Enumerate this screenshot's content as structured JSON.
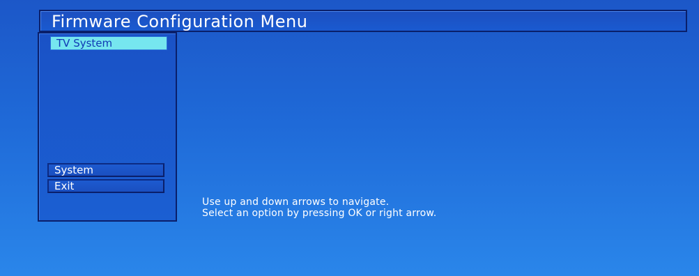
{
  "title": "Firmware Configuration Menu",
  "menu": {
    "items": [
      {
        "label": "TV System",
        "selected": true
      },
      {
        "label": "System",
        "selected": false
      },
      {
        "label": "Exit",
        "selected": false
      }
    ]
  },
  "help": {
    "line1": "Use up and down arrows to navigate.",
    "line2": "Select an option by pressing OK or right arrow."
  },
  "colors": {
    "background": "#1f6ad8",
    "selected_item": "#76e6ef",
    "text": "#ffffff",
    "border": "#0a1f6a"
  }
}
